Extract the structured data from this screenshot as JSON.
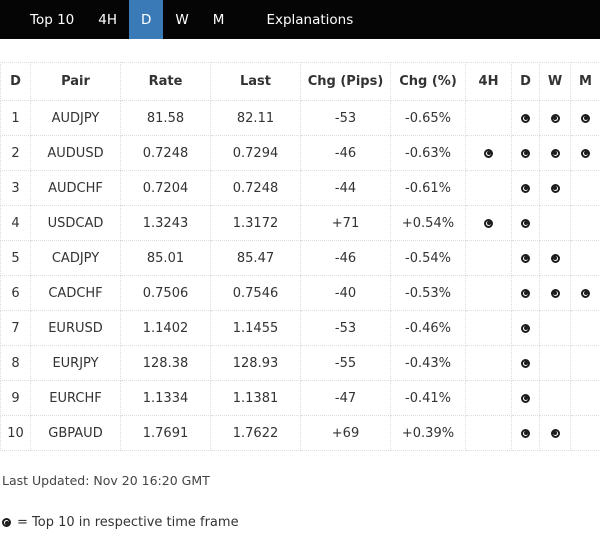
{
  "nav": {
    "tabs": [
      {
        "label": "Top 10",
        "active": false
      },
      {
        "label": "4H",
        "active": false
      },
      {
        "label": "D",
        "active": true
      },
      {
        "label": "W",
        "active": false
      },
      {
        "label": "M",
        "active": false
      },
      {
        "label": "Explanations",
        "active": false
      }
    ]
  },
  "colors": {
    "nav_bg": "#050505",
    "active_tab_bg": "#3a7ab7",
    "text": "#333333",
    "border": "#dcdcdc",
    "icon": "#1c1c1c"
  },
  "table": {
    "columns": [
      "D",
      "Pair",
      "Rate",
      "Last",
      "Chg (Pips)",
      "Chg (%)",
      "4H",
      "D",
      "W",
      "M"
    ],
    "rows": [
      {
        "rank": "1",
        "pair": "AUDJPY",
        "rate": "81.58",
        "last": "82.11",
        "chg_pips": "-53",
        "chg_pct": "-0.65%",
        "h4": false,
        "d": true,
        "w": true,
        "m": true
      },
      {
        "rank": "2",
        "pair": "AUDUSD",
        "rate": "0.7248",
        "last": "0.7294",
        "chg_pips": "-46",
        "chg_pct": "-0.63%",
        "h4": true,
        "d": true,
        "w": true,
        "m": true
      },
      {
        "rank": "3",
        "pair": "AUDCHF",
        "rate": "0.7204",
        "last": "0.7248",
        "chg_pips": "-44",
        "chg_pct": "-0.61%",
        "h4": false,
        "d": true,
        "w": true,
        "m": false
      },
      {
        "rank": "4",
        "pair": "USDCAD",
        "rate": "1.3243",
        "last": "1.3172",
        "chg_pips": "+71",
        "chg_pct": "+0.54%",
        "h4": true,
        "d": true,
        "w": false,
        "m": false
      },
      {
        "rank": "5",
        "pair": "CADJPY",
        "rate": "85.01",
        "last": "85.47",
        "chg_pips": "-46",
        "chg_pct": "-0.54%",
        "h4": false,
        "d": true,
        "w": true,
        "m": false
      },
      {
        "rank": "6",
        "pair": "CADCHF",
        "rate": "0.7506",
        "last": "0.7546",
        "chg_pips": "-40",
        "chg_pct": "-0.53%",
        "h4": false,
        "d": true,
        "w": true,
        "m": true
      },
      {
        "rank": "7",
        "pair": "EURUSD",
        "rate": "1.1402",
        "last": "1.1455",
        "chg_pips": "-53",
        "chg_pct": "-0.46%",
        "h4": false,
        "d": true,
        "w": false,
        "m": false
      },
      {
        "rank": "8",
        "pair": "EURJPY",
        "rate": "128.38",
        "last": "128.93",
        "chg_pips": "-55",
        "chg_pct": "-0.43%",
        "h4": false,
        "d": true,
        "w": false,
        "m": false
      },
      {
        "rank": "9",
        "pair": "EURCHF",
        "rate": "1.1334",
        "last": "1.1381",
        "chg_pips": "-47",
        "chg_pct": "-0.41%",
        "h4": false,
        "d": true,
        "w": false,
        "m": false
      },
      {
        "rank": "10",
        "pair": "GBPAUD",
        "rate": "1.7691",
        "last": "1.7622",
        "chg_pips": "+69",
        "chg_pct": "+0.39%",
        "h4": false,
        "d": true,
        "w": true,
        "m": false
      }
    ]
  },
  "footer": {
    "last_updated": "Last Updated: Nov 20 16:20 GMT",
    "legend_icon": "dot-circle-icon",
    "legend_text": "= Top 10 in respective time frame"
  }
}
